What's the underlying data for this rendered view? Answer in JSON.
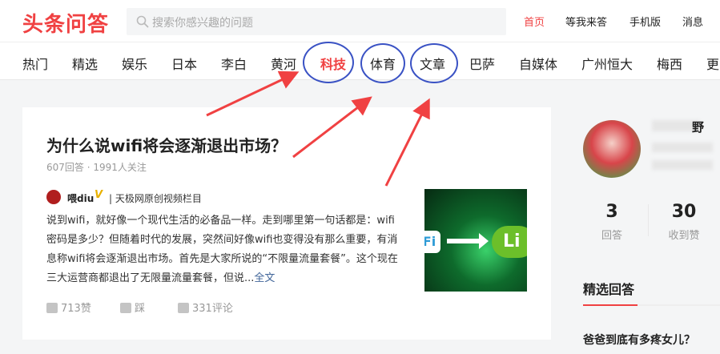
{
  "header": {
    "logo": "头条问答",
    "search_placeholder": "搜索你感兴趣的问题",
    "nav": [
      {
        "label": "首页",
        "active": true
      },
      {
        "label": "等我来答",
        "active": false
      },
      {
        "label": "手机版",
        "active": false
      },
      {
        "label": "消息",
        "active": false
      }
    ]
  },
  "channels": [
    "热门",
    "精选",
    "娱乐",
    "日本",
    "李白",
    "黄河",
    "科技",
    "体育",
    "文章",
    "巴萨",
    "自媒体",
    "广州恒大",
    "梅西",
    "更"
  ],
  "active_channel": "科技",
  "highlighted_channels": [
    "科技",
    "体育",
    "文章"
  ],
  "annotation_color": "#f04142",
  "ring_color": "#3a52c4",
  "question": {
    "title": "为什么说wifi将会逐渐退出市场？",
    "meta": "607回答 · 1991人关注",
    "author": {
      "name": "喂diu",
      "badge": "V",
      "description": "| 天极网原创视频栏目"
    },
    "excerpt": "说到wifi，就好像一个现代生活的必备品一样。走到哪里第一句话都是：wifi密码是多少？但随着时代的发展，突然间好像wifi也变得没有那么重要，有消息称wifi将会逐渐退出市场。首先是大家所说的“不限量流量套餐”。这个现在三大运营商都退出了无限量流量套餐，但说...",
    "more": "全文",
    "thumb": {
      "left_text": "Fi",
      "right_text": "Li"
    },
    "actions": {
      "likes": "713赞",
      "dislike": "踩",
      "comments": "331评论"
    }
  },
  "sidebar": {
    "name_partial": "野",
    "stats": [
      {
        "value": "3",
        "label": "回答"
      },
      {
        "value": "30",
        "label": "收到赞"
      }
    ],
    "section_title": "精选回答",
    "featured_question": "爸爸到底有多疼女儿？"
  }
}
